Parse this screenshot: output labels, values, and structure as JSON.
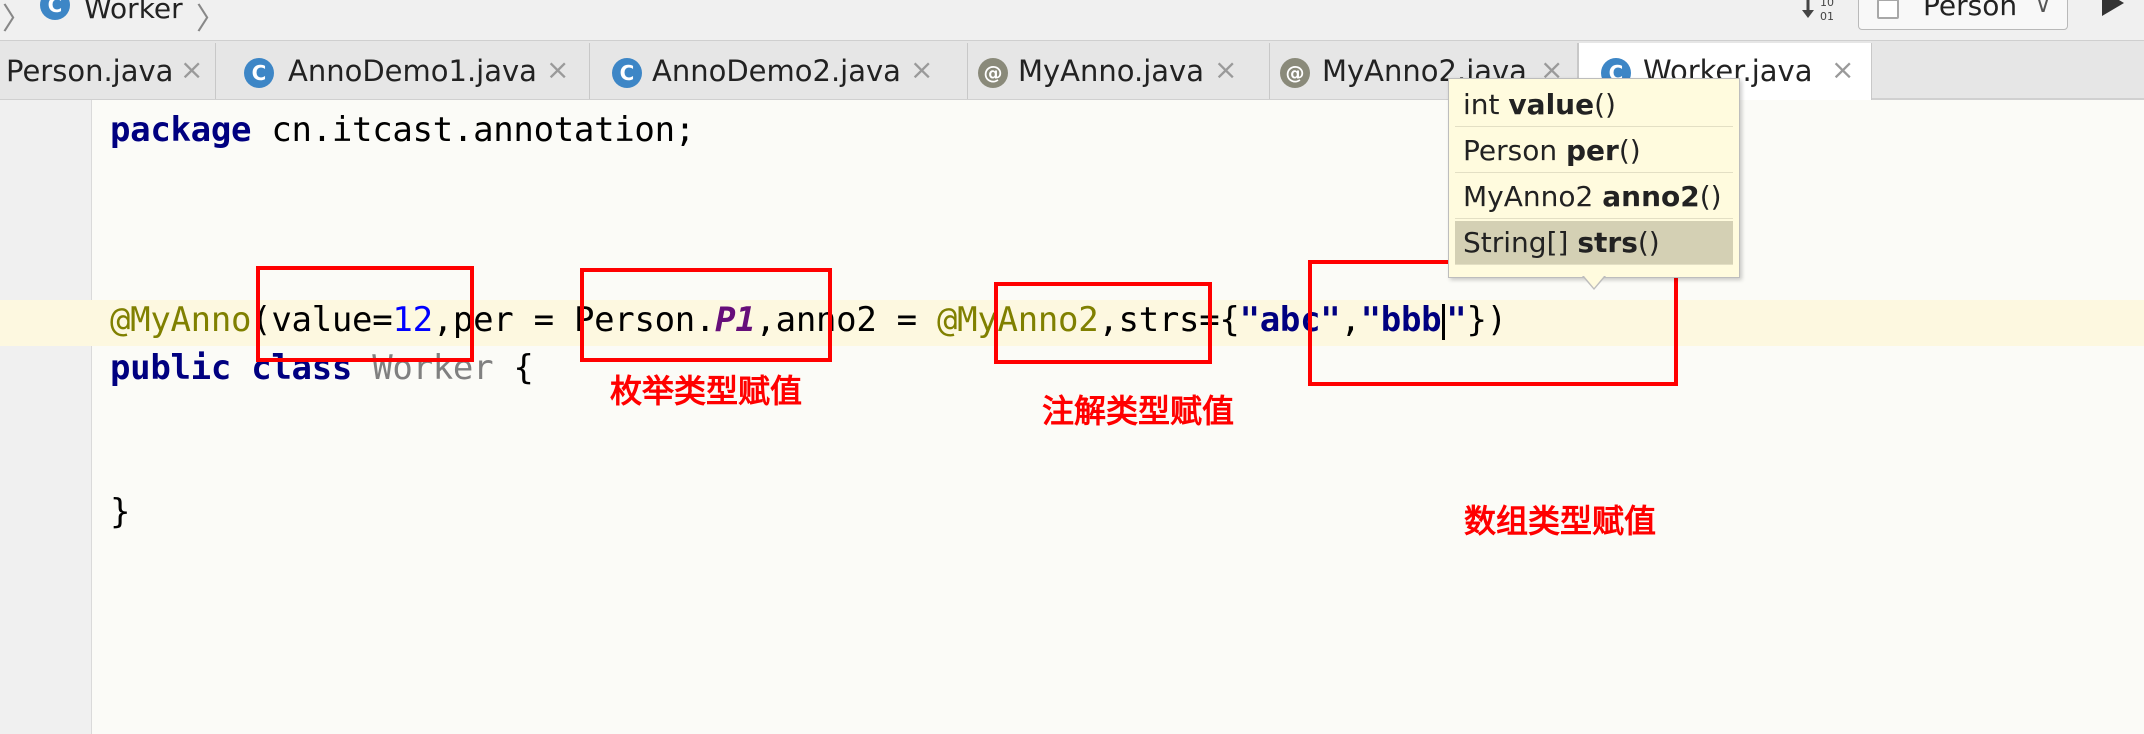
{
  "breadcrumb": {
    "icon_letter": "C",
    "text": "Worker"
  },
  "toolbar": {
    "run_config_label": "Person"
  },
  "tabs": [
    {
      "icon": "class-icon",
      "icon_letter": "",
      "label": "Person.java",
      "close": "×",
      "active": false
    },
    {
      "icon": "class-icon",
      "icon_letter": "C",
      "label": "AnnoDemo1.java",
      "close": "×",
      "active": false
    },
    {
      "icon": "class-icon",
      "icon_letter": "C",
      "label": "AnnoDemo2.java",
      "close": "×",
      "active": false
    },
    {
      "icon": "annotation-icon",
      "icon_letter": "@",
      "label": "MyAnno.java",
      "close": "×",
      "active": false
    },
    {
      "icon": "annotation-icon",
      "icon_letter": "@",
      "label": "MyAnno2.java",
      "close": "×",
      "active": false
    },
    {
      "icon": "class-icon",
      "icon_letter": "C",
      "label": "Worker.java",
      "close": "×",
      "active": true
    }
  ],
  "code": {
    "line1": {
      "keyword": "package",
      "rest": " cn.itcast.annotation;"
    },
    "line4": {
      "anno": "@MyAnno",
      "p1": "(value=",
      "num": "12",
      "p2": ",per = Person.",
      "const": "P1",
      "p3": ",anno2 = ",
      "anno2": "@MyAnno2",
      "p4": ",strs={",
      "str1": "\"abc\"",
      "comma": ",",
      "str2a": "\"bbb",
      "str2b": "\"",
      "p5": "})"
    },
    "line5": {
      "kw1": "public",
      "kw2": "class",
      "name": "Worker",
      "brace": " {"
    },
    "line8": {
      "brace": "}"
    }
  },
  "annotations": {
    "enum_label": "枚举类型赋值",
    "annotation_label": "注解类型赋值",
    "array_label": "数组类型赋值"
  },
  "completion_popup": {
    "items": [
      {
        "type": "int",
        "name": "value",
        "suffix": "()"
      },
      {
        "type": "Person",
        "name": "per",
        "suffix": "()"
      },
      {
        "type": "MyAnno2",
        "name": "anno2",
        "suffix": "()"
      },
      {
        "type": "String[]",
        "name": "strs",
        "suffix": "()"
      }
    ]
  },
  "colors": {
    "keyword": "#000080",
    "annotation": "#808000",
    "number": "#0000ff",
    "highlight_box": "#ff0000",
    "popup_bg": "#fffbde"
  }
}
